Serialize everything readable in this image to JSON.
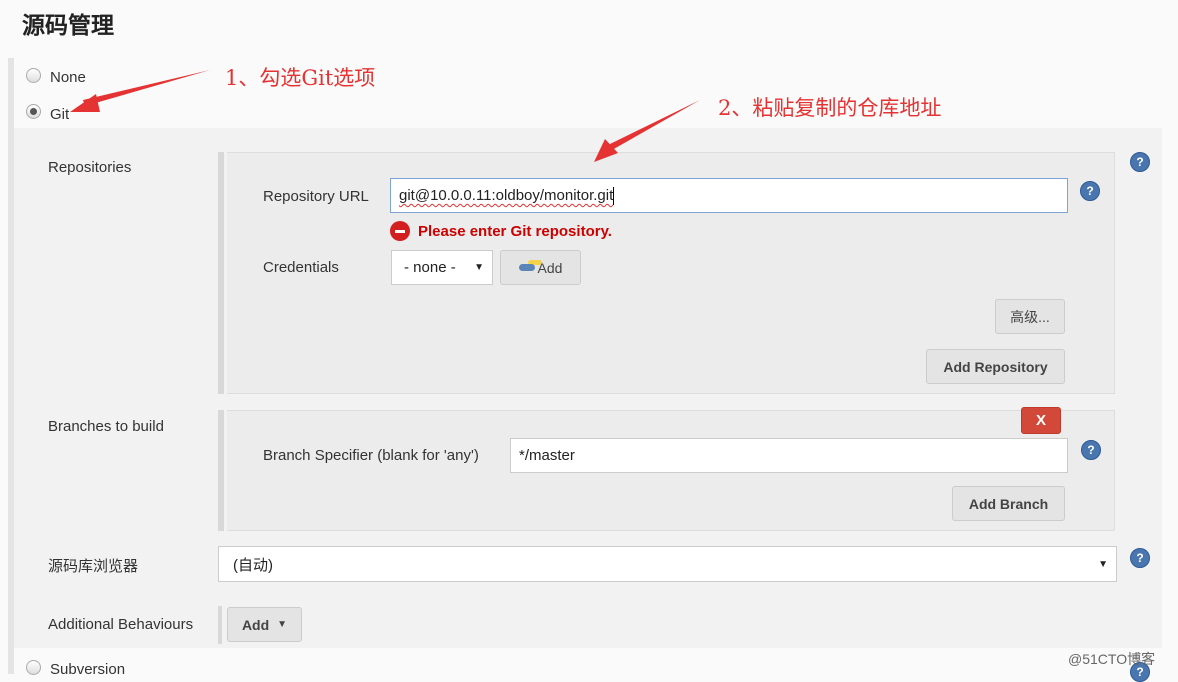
{
  "page_title": "源码管理",
  "scm_options": {
    "none": "None",
    "git": "Git",
    "subversion": "Subversion"
  },
  "repositories": {
    "label": "Repositories",
    "url_label": "Repository URL",
    "url_value": "git@10.0.0.11:oldboy/monitor.git",
    "error": "Please enter Git repository.",
    "credentials_label": "Credentials",
    "credentials_value": "- none -",
    "add_label": "Add",
    "advanced_label": "高级...",
    "add_repository_label": "Add Repository"
  },
  "branches": {
    "label": "Branches to build",
    "delete_label": "X",
    "specifier_label": "Branch Specifier (blank for 'any')",
    "specifier_value": "*/master",
    "add_branch_label": "Add Branch"
  },
  "browser": {
    "label": "源码库浏览器",
    "value": "(自动)"
  },
  "behaviours": {
    "label": "Additional Behaviours",
    "add_label": "Add"
  },
  "annotations": {
    "step1": "1、勾选Git选项",
    "step2": "2、粘贴复制的仓库地址"
  },
  "watermark": "@51CTO博客",
  "colors": {
    "error": "#cc0000",
    "annotation": "#e53333",
    "delete": "#d24939",
    "help": "#4a76b0"
  }
}
